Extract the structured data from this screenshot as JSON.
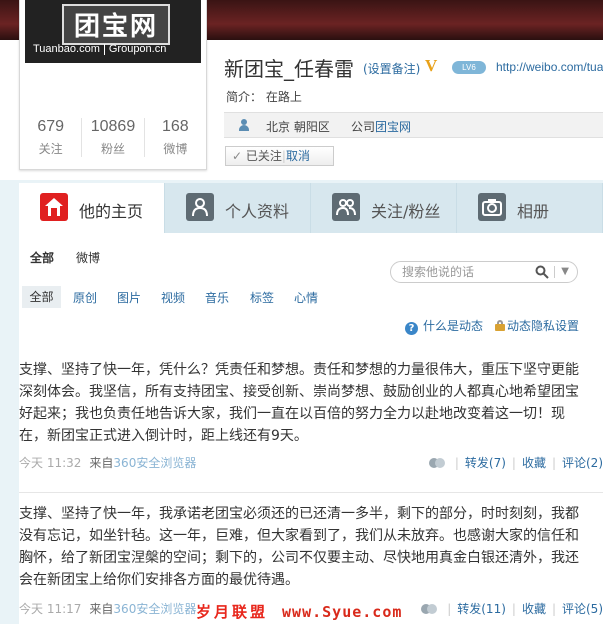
{
  "profile": {
    "logo_text": "团宝网",
    "logo_sub_left": "Tuanbao.com",
    "logo_sub_right": "Groupon.cn",
    "nickname": "新团宝_任春雷",
    "remark_link": "(设置备注)",
    "v_badge": "V",
    "level_badge": "LV6",
    "weibo_url": "http://weibo.com/tua",
    "intro": "简介：  在路上",
    "location": "北京 朝阳区",
    "company_prefix": "公司",
    "company": "团宝网",
    "follow_state": "已关注",
    "follow_cancel": "取消",
    "stats": [
      {
        "num": "679",
        "label": "关注"
      },
      {
        "num": "10869",
        "label": "粉丝"
      },
      {
        "num": "168",
        "label": "微博"
      }
    ]
  },
  "tabs": [
    {
      "label": "他的主页",
      "icon": "home-icon",
      "active": true
    },
    {
      "label": "个人资料",
      "icon": "person-icon",
      "active": false
    },
    {
      "label": "关注/粉丝",
      "icon": "people-icon",
      "active": false
    },
    {
      "label": "相册",
      "icon": "camera-icon",
      "active": false
    }
  ],
  "filters": {
    "main": [
      "全部",
      "微博"
    ],
    "search_placeholder": "搜索他说的话",
    "types": [
      "全部",
      "原创",
      "图片",
      "视频",
      "音乐",
      "标签",
      "心情"
    ],
    "help_link": "什么是动态",
    "privacy_link": "动态隐私设置"
  },
  "posts": [
    {
      "text": "支撑、坚持了快一年，凭什么？凭责任和梦想。责任和梦想的力量很伟大，重压下坚守更能深刻体会。我坚信，所有支持团宝、接受创新、崇尚梦想、鼓励创业的人都真心地希望团宝好起来；我也负责任地告诉大家，我们一直在以百倍的努力全力以赴地改变着这一切！现在，新团宝正式进入倒计时，距上线还有9天。",
      "time": "今天 11:32",
      "from_label": "来自",
      "source": "360安全浏览器",
      "forward": "转发(7)",
      "favorite": "收藏",
      "comment": "评论(2)"
    },
    {
      "text": "支撑、坚持了快一年，我承诺老团宝必须还的已还清一多半，剩下的部分，时时刻刻，我都没有忘记，如坐针毡。这一年，巨难，但大家看到了，我们从未放弃。也感谢大家的信任和胸怀，给了新团宝涅槃的空间；剩下的，公司不仅要主动、尽快地用真金白银还清外，我还会在新团宝上给你们安排各方面的最优待遇。",
      "time": "今天 11:17",
      "from_label": "来自",
      "source": "360安全浏览器",
      "forward": "转发(11)",
      "favorite": "收藏",
      "comment": "评论(5)"
    }
  ],
  "watermark": {
    "text": "岁月联盟",
    "url": "www.Syue.com"
  },
  "colors": {
    "accent_red": "#e02020",
    "link_blue": "#2c6ba0",
    "tab_bg": "#d7e7ee"
  }
}
